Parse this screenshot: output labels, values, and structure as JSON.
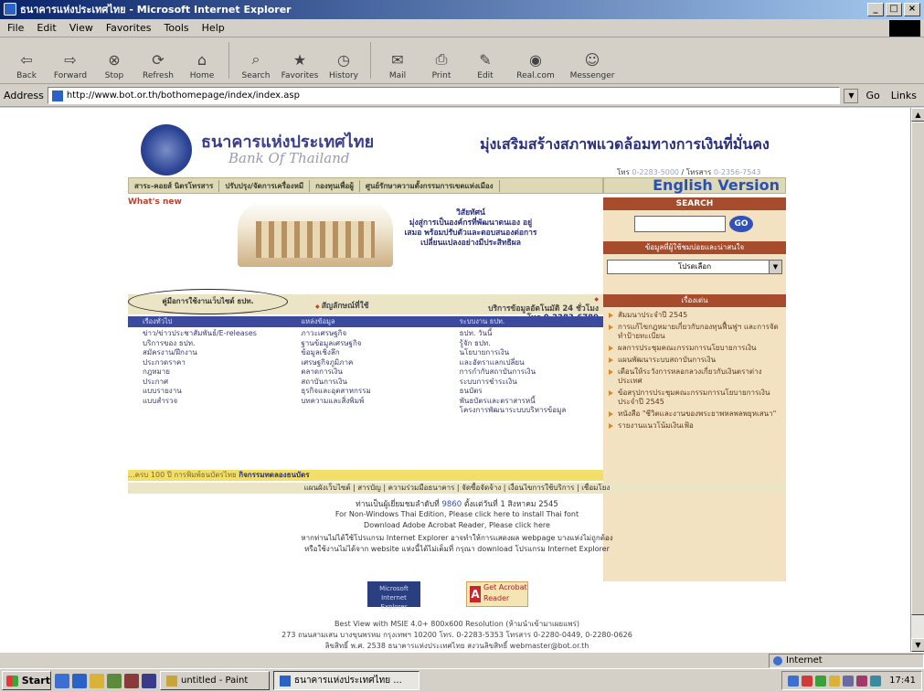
{
  "window": {
    "title": "ธนาคารแห่งประเทศไทย - Microsoft Internet Explorer",
    "controls": [
      "_",
      "□",
      "×"
    ]
  },
  "menu": [
    "File",
    "Edit",
    "View",
    "Favorites",
    "Tools",
    "Help"
  ],
  "toolbar": [
    {
      "label": "Back",
      "icon": "back-arrow"
    },
    {
      "label": "Forward",
      "icon": "forward-arrow"
    },
    {
      "label": "Stop",
      "icon": "stop"
    },
    {
      "label": "Refresh",
      "icon": "refresh"
    },
    {
      "label": "Home",
      "icon": "home"
    },
    {
      "label": "Search",
      "icon": "search"
    },
    {
      "label": "Favorites",
      "icon": "favorites"
    },
    {
      "label": "History",
      "icon": "history"
    },
    {
      "label": "Mail",
      "icon": "mail"
    },
    {
      "label": "Print",
      "icon": "print"
    },
    {
      "label": "Edit",
      "icon": "edit"
    },
    {
      "label": "Real.com",
      "icon": "realcom"
    },
    {
      "label": "Messenger",
      "icon": "messenger"
    }
  ],
  "address": {
    "label": "Address",
    "url": "http://www.bot.or.th/bothomepage/index/index.asp",
    "go": "Go",
    "links": "Links"
  },
  "page": {
    "logo_th": "ธนาคารแห่งประเทศไทย",
    "logo_en": "Bank Of Thailand",
    "slogan": "มุ่งเสริมสร้างสภาพแวดล้อมทางการเงินที่มั่นคง",
    "phone_label": "โทร",
    "phone": "0-2283-5000",
    "fax_label": "โทรสาร",
    "fax": "0-2356-7543",
    "nav": [
      "สาระ-คอยส์ นิตรโทรสาร",
      "ปรับปรุง/จัดการเครื่องหมี",
      "กองทุนเพื่อผู้",
      "ศูนย์รักษาความตั้งกรรมการเขตแห่งเมือง"
    ],
    "english_version": "English Version",
    "whats_new": "What's new",
    "vision_title": "วิสัยทัศน์",
    "vision_text": "มุ่งสู่การเป็นองค์กรที่พัฒนาตนเอง อยู่เสมอ พร้อมปรับตัวและตอบสนองต่อการ เปลี่ยนแปลงอย่างมีประสิทธิผล",
    "search_head": "SEARCH",
    "search_go": "GO",
    "info_head": "ข้อมูลที่ผู้ใช้ชมบ่อยและน่าสนใจ",
    "select_default": "โปรดเลือก",
    "news_head": "เรื่องเด่น",
    "news": [
      "สัมมนาประจำปี 2545",
      "การแก้ไขกฎหมายเกี่ยวกับกองทุนฟื้นฟูฯ และการจัดทำป้ายทะเบียน",
      "ผลการประชุมคณะกรรมการนโยบายการเงิน",
      "แผนพัฒนาระบบสถาบันการเงิน",
      "เตือนให้ระวังการหลอกลวงเกี่ยวกับเงินตราต่างประเทศ",
      "ข้อสรุปการประชุมคณะกรรมการนโยบายการเงินประจำปี 2545",
      "หนังสือ \"ชีวิตและงานของพระยาพหลพลพยุหเสนา\"",
      "รายงานแนวโน้มเงินเฟ้อ"
    ],
    "guide_link": "คู่มือการใช้งานเว็บไซต์ ธปท.",
    "symbol_link": "สัญลักษณ์ที่ใช้",
    "service_line1": "บริการข้อมูลอัตโนมัติ 24 ชั่วโมง",
    "service_line2_prefix": "โทร.",
    "service_phone": "0-2283-6789",
    "col_heads": [
      "เรื่องทั่วไป",
      "แหล่งข้อมูล",
      "ระบบงาน ธปท."
    ],
    "col1": [
      "ข่าว/ข่าวประชาสัมพันธ์/E-releases",
      "บริการของ ธปท.",
      "สมัครงาน/ฝึกงาน",
      "ประกวดราคา",
      "กฎหมาย",
      "ประกาศ",
      "แบบรายงาน",
      "แบบสำรวจ"
    ],
    "col2": [
      "ภาวะเศรษฐกิจ",
      "ฐานข้อมูลเศรษฐกิจ",
      "ข้อมูลเชิงลึก",
      "เศรษฐกิจภูมิภาค",
      "ตลาดการเงิน",
      "สถาบันการเงิน",
      "ธุรกิจและอุตสาหกรรม",
      "บทความและสิ่งพิมพ์"
    ],
    "col3": [
      "ธปท. วันนี้",
      "รู้จัก ธปท.",
      "นโยบายการเงิน",
      "และอัตราแลกเปลี่ยน",
      "การกำกับสถาบันการเงิน",
      "ระบบการชำระเงิน",
      "ธนบัตร",
      "พันธบัตรและตราสารหนี้",
      "โครงการพัฒนาระบบบริหารข้อมูล"
    ],
    "marquee_text": "...ครบ 100 ปี การพิมพ์ธนบัตรไทย",
    "marquee_bold": "กิจกรรมทดลองธนบัตร",
    "bottom_links": "แผนผังเว็บไซต์ | สารบัญ | ความร่วมมือธนาคาร | จัดซื้อจัดจ้าง | เงื่อนไขการใช้บริการ | เชื่อมโยง",
    "counter_prefix": "ท่านเป็นผู้เยี่ยมชมลำดับที่",
    "counter": "9860",
    "counter_suffix": "ตั้งแต่วันที่ 1 สิงหาคม 2545",
    "nonwin": "For Non-Windows Thai Edition, Please click here to install Thai font",
    "acrobat": "Download Adobe Acrobat Reader, Please click here",
    "ie_note1": "หากท่านไม่ได้ใช้โปรแกรม Internet Explorer อาจทำให้การแสดงผล webpage บางแห่งไม่ถูกต้อง",
    "ie_note2": "หรือใช้งานไม่ได้จาก website แห่งนี้ได้ไม่เต็มที่ กรุณา download โปรแกรม Internet Explorer",
    "badge1": "Microsoft Internet Explorer",
    "badge2": "Get Acrobat Reader",
    "best_view": "Best View with MSIE 4.0+ 800x600 Resolution (ห้ามนำเข้ามาเผยแพร่)",
    "address_line": "273 ถนนสามเสน บางขุนพรหม กรุงเทพฯ 10200 โทร. 0-2283-5353 โทรสาร 0-2280-0449, 0-2280-0626",
    "copyright": "ลิขสิทธิ์ พ.ศ. 2538 ธนาคารแห่งประเทศไทย สงวนลิขสิทธิ์ webmaster@bot.or.th"
  },
  "status": {
    "left": "",
    "zone": "Internet"
  },
  "taskbar": {
    "start": "Start",
    "items": [
      {
        "label": "untitled - Paint",
        "active": false
      },
      {
        "label": "ธนาคารแห่งประเทศไทย ...",
        "active": true
      }
    ],
    "clock": "17:41"
  }
}
